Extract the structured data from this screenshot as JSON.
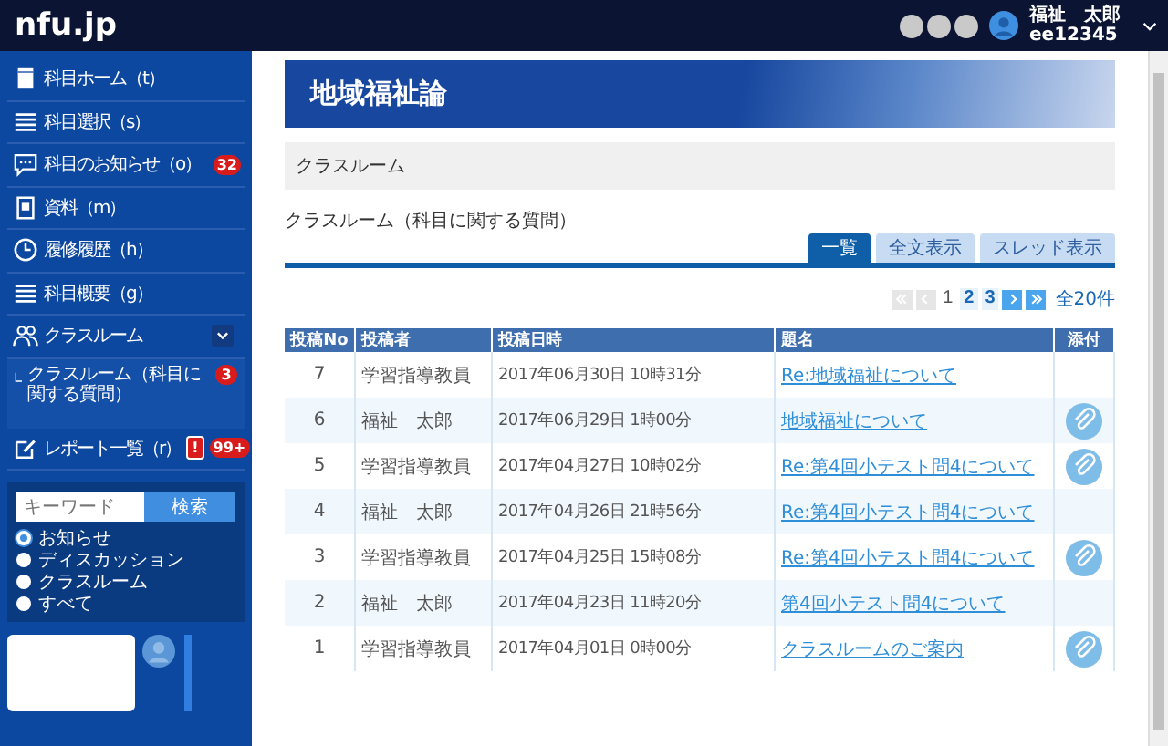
{
  "app": {
    "logo": "nfu.jp"
  },
  "user": {
    "name": "福祉　太郎",
    "id": "ee12345"
  },
  "sidebar": {
    "items": [
      {
        "label": "科目ホーム（t）"
      },
      {
        "label": "科目選択（s）"
      },
      {
        "label": "科目のお知らせ（o）",
        "badges": [
          {
            "text": "32",
            "kind": "count"
          }
        ]
      },
      {
        "label": "資料（m）"
      },
      {
        "label": "履修履歴（h）"
      },
      {
        "label": "科目概要（g）"
      },
      {
        "label": "クラスルーム",
        "expanded": true,
        "children": [
          {
            "label": "クラスルーム（科目に関する質問）",
            "badges": [
              {
                "text": "3",
                "kind": "count"
              }
            ]
          }
        ]
      },
      {
        "label": "レポート一覧（r）",
        "badges": [
          {
            "text": "!",
            "kind": "alert"
          },
          {
            "text": "99+",
            "kind": "count"
          }
        ]
      }
    ]
  },
  "search": {
    "placeholder": "キーワード",
    "button": "検索",
    "scopes": [
      {
        "label": "お知らせ",
        "selected": true
      },
      {
        "label": "ディスカッション",
        "selected": false
      },
      {
        "label": "クラスルーム",
        "selected": false
      },
      {
        "label": "すべて",
        "selected": false
      }
    ]
  },
  "course": {
    "title": "地域福祉論"
  },
  "section": "クラスルーム",
  "heading": "クラスルーム（科目に関する質問）",
  "tabs": [
    {
      "label": "一覧",
      "selected": true
    },
    {
      "label": "全文表示",
      "selected": false
    },
    {
      "label": "スレッド表示",
      "selected": false
    }
  ],
  "pagination": {
    "nav": [
      {
        "kind": "first",
        "disabled": true
      },
      {
        "kind": "prev",
        "disabled": true
      }
    ],
    "pages": [
      {
        "label": "1",
        "selected": true
      },
      {
        "label": "2",
        "selected": false
      },
      {
        "label": "3",
        "selected": false
      }
    ],
    "nav_after": [
      {
        "kind": "next",
        "disabled": false
      },
      {
        "kind": "last",
        "disabled": false
      }
    ],
    "total": "全20件"
  },
  "table": {
    "columns": [
      "投稿No",
      "投稿者",
      "投稿日時",
      "題名",
      "添付"
    ],
    "rows": [
      {
        "no": "7",
        "author": "学習指導教員",
        "date": "2017年06月30日 10時31分",
        "title": "Re:地域福祉について",
        "attachment": false
      },
      {
        "no": "6",
        "author": "福祉　太郎",
        "date": "2017年06月29日 1時00分",
        "title": "地域福祉について",
        "attachment": true
      },
      {
        "no": "5",
        "author": "学習指導教員",
        "date": "2017年04月27日 10時02分",
        "title": "Re:第4回小テスト問4について",
        "attachment": true
      },
      {
        "no": "4",
        "author": "福祉　太郎",
        "date": "2017年04月26日 21時56分",
        "title": "Re:第4回小テスト問4について",
        "attachment": false
      },
      {
        "no": "3",
        "author": "学習指導教員",
        "date": "2017年04月25日 15時08分",
        "title": "Re:第4回小テスト問4について",
        "attachment": true
      },
      {
        "no": "2",
        "author": "福祉　太郎",
        "date": "2017年04月23日 11時20分",
        "title": "第4回小テスト問4について",
        "attachment": false
      },
      {
        "no": "1",
        "author": "学習指導教員",
        "date": "2017年04月01日 0時00分",
        "title": "クラスルームのご案内",
        "attachment": true
      }
    ]
  }
}
